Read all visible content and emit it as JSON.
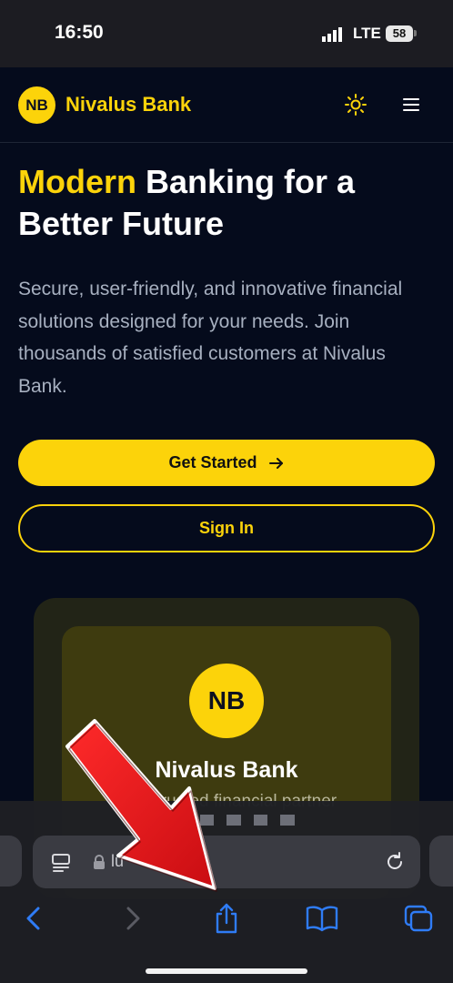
{
  "status_bar": {
    "time": "16:50",
    "network": "LTE",
    "battery": "58"
  },
  "header": {
    "logo_initials": "NB",
    "brand_name": "Nivalus Bank",
    "theme_icon": "sun-icon",
    "menu_icon": "hamburger-menu-icon"
  },
  "hero": {
    "headline_highlight": "Modern",
    "headline_rest_line1": " Banking for a",
    "headline_line2": "Better Future",
    "description": "Secure, user-friendly, and innovative financial solutions designed for your needs. Join thousands of satisfied customers at Nivalus Bank.",
    "primary_button": "Get Started",
    "secondary_button": "Sign In"
  },
  "card": {
    "logo_initials": "NB",
    "title": "Nivalus Bank",
    "subtitle": "Your trusted financial partner"
  },
  "browser": {
    "url_partial": "lu",
    "icons": [
      "page-menu-icon",
      "lock-icon",
      "reload-icon",
      "back-icon",
      "forward-icon",
      "share-icon",
      "bookmarks-icon",
      "tabs-icon"
    ]
  },
  "colors": {
    "accent": "#fcd30a",
    "background": "#050b1c",
    "annotation_arrow": "#e8141b",
    "ios_blue": "#2f7cf6"
  }
}
